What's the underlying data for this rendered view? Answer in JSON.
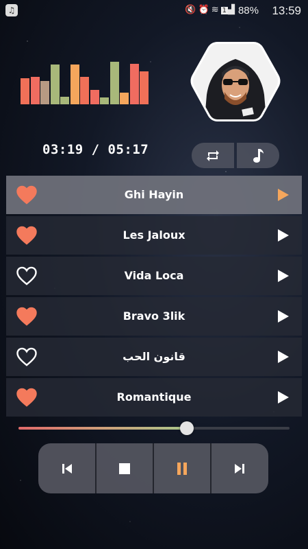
{
  "status_bar": {
    "battery": "88%",
    "time": "13:59",
    "sim_badge": "1",
    "icons": [
      "app-notification-icon",
      "mute-icon",
      "alarm-icon",
      "wifi-icon",
      "sim-icon",
      "signal-icon",
      "battery-icon"
    ]
  },
  "equalizer": {
    "levels": [
      0.62,
      0.64,
      0.55,
      0.93,
      0.18,
      0.93,
      0.64,
      0.34,
      0.16,
      1.0,
      0.28,
      0.95,
      0.78
    ],
    "colors": [
      "#f07058",
      "#f06c60",
      "#b79a83",
      "#a8b87a",
      "#a8b87a",
      "#f5a65c",
      "#f07058",
      "#f06c60",
      "#a8b87a",
      "#a8b87a",
      "#f5a65c",
      "#f06c60",
      "#f07058"
    ]
  },
  "player": {
    "time_display": "03:19 / 05:17",
    "progress": 0.62
  },
  "mode_buttons": [
    {
      "icon": "repeat-icon"
    },
    {
      "icon": "music-note-icon"
    }
  ],
  "tracks": [
    {
      "title": "Ghi Hayin",
      "favorite": true,
      "active": true
    },
    {
      "title": "Les Jaloux",
      "favorite": true,
      "active": false
    },
    {
      "title": "Vida Loca",
      "favorite": false,
      "active": false
    },
    {
      "title": "Bravo 3lik",
      "favorite": true,
      "active": false
    },
    {
      "title": "قانون الحب",
      "favorite": false,
      "active": false
    },
    {
      "title": "Romantique",
      "favorite": true,
      "active": false
    }
  ],
  "controls": [
    {
      "icon": "skip-previous-icon"
    },
    {
      "icon": "stop-icon"
    },
    {
      "icon": "pause-icon"
    },
    {
      "icon": "skip-next-icon"
    }
  ],
  "colors": {
    "accent": "#f5a65c",
    "heart": "#f47a5c",
    "active_row": "#70727c",
    "row": "#262a34"
  }
}
